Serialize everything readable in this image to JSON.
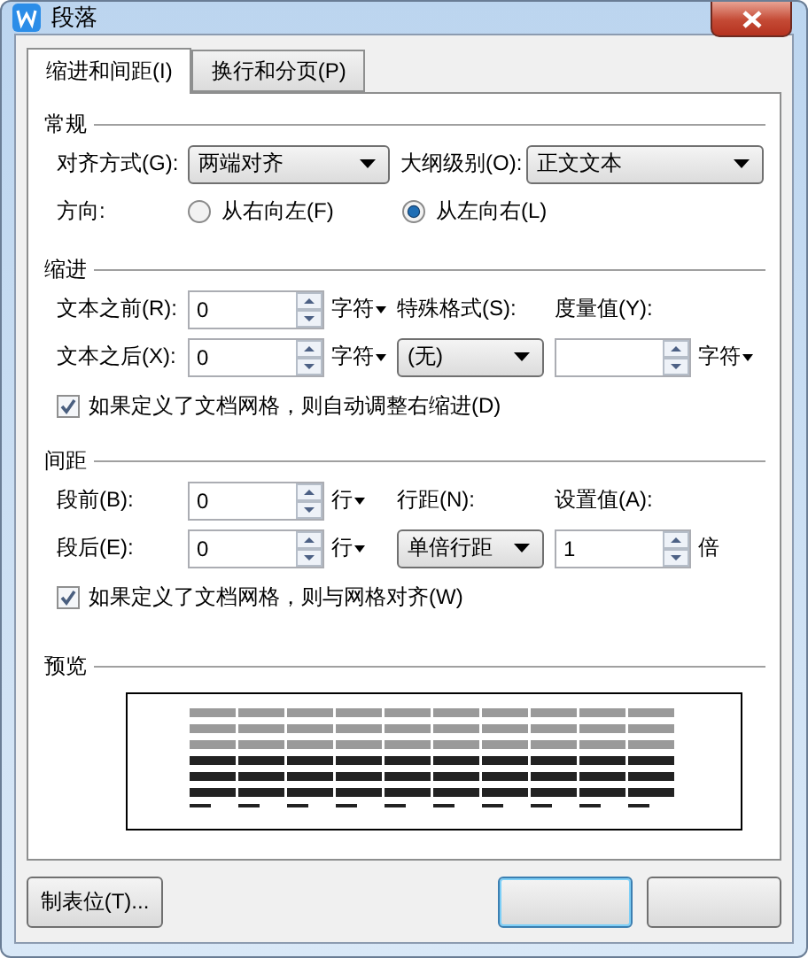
{
  "window": {
    "title": "段落"
  },
  "tabs": [
    {
      "label": "缩进和间距(I)",
      "selected": true
    },
    {
      "label": "换行和分页(P)",
      "selected": false
    }
  ],
  "general": {
    "title": "常规",
    "alignment": {
      "label": "对齐方式(G):",
      "value": "两端对齐"
    },
    "outline_level": {
      "label": "大纲级别(O):",
      "value": "正文文本"
    },
    "direction": {
      "label": "方向:",
      "options": [
        {
          "label": "从右向左(F)",
          "selected": false
        },
        {
          "label": "从左向右(L)",
          "selected": true
        }
      ]
    }
  },
  "indent": {
    "title": "缩进",
    "before": {
      "label": "文本之前(R):",
      "value": "0",
      "unit": "字符",
      "unit_menu": true
    },
    "after": {
      "label": "文本之后(X):",
      "value": "0",
      "unit": "字符",
      "unit_menu": true
    },
    "special": {
      "label": "特殊格式(S):",
      "value": "(无)"
    },
    "measure": {
      "label": "度量值(Y):",
      "unit": "字符",
      "unit_menu": true
    },
    "grid_option": {
      "label": "如果定义了文档网格，则自动调整右缩进(D)",
      "checked": true
    }
  },
  "spacing": {
    "title": "间距",
    "before": {
      "label": "段前(B):",
      "value": "0",
      "unit": "行",
      "unit_menu": true
    },
    "after": {
      "label": "段后(E):",
      "value": "0",
      "unit": "行",
      "unit_menu": true
    },
    "line_spacing": {
      "label": "行距(N):",
      "value": "单倍行距"
    },
    "setting": {
      "label": "设置值(A):",
      "value": "1",
      "unit": "倍",
      "unit_menu": false
    },
    "grid_option": {
      "label": "如果定义了文档网格，则与网格对齐(W)",
      "checked": true
    }
  },
  "preview": {
    "title": "预览"
  },
  "tab_stops_button": "制表位(T)..."
}
